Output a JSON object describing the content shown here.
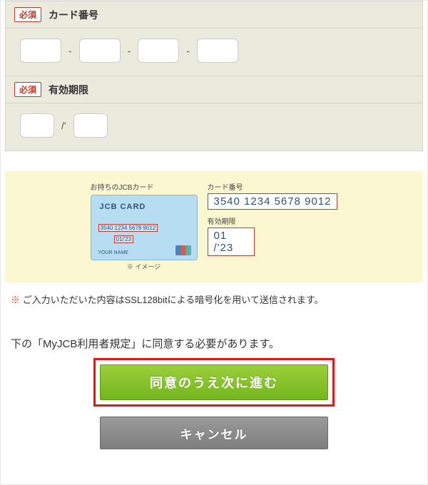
{
  "badges": {
    "required": "必須"
  },
  "fields": {
    "card_number": {
      "label": "カード番号",
      "separator": "-"
    },
    "expiry": {
      "label": "有効期限",
      "separator": "/'"
    }
  },
  "guide": {
    "own_card": "お持ちのJCBカード",
    "caption": "※ イメージ",
    "card": {
      "brand": "JCB CARD",
      "number_small": "3540 1234 5678 9012",
      "exp_small": "01/'23",
      "holder": "YOUR NAME"
    },
    "number_label": "カード番号",
    "number_value": "3540 1234 5678 9012",
    "expiry_label": "有効期限",
    "expiry_value": "01 /'23"
  },
  "ssl_note": {
    "mark": "※",
    "text": "ご入力いただいた内容はSSL128bitによる暗号化を用いて送信されます。"
  },
  "consent_text": "下の「MyJCB利用者規定」に同意する必要があります。",
  "buttons": {
    "agree": "同意のうえ次に進む",
    "cancel": "キャンセル"
  }
}
